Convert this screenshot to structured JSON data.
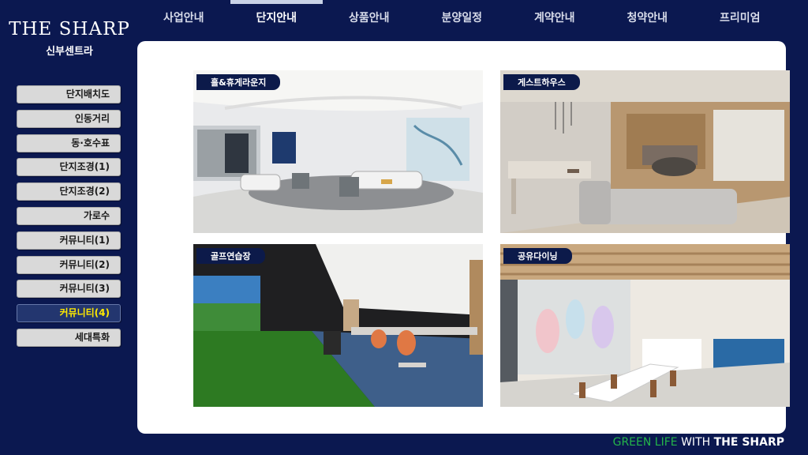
{
  "logo": {
    "main": "THE SHARP",
    "sub": "신부센트라"
  },
  "nav": {
    "tabs": [
      "사업안내",
      "단지안내",
      "상품안내",
      "분양일정",
      "계약안내",
      "청약안내",
      "프리미엄"
    ],
    "active": 1
  },
  "sidebar": {
    "items": [
      "단지배치도",
      "인동거리",
      "동·호수표",
      "단지조경(1)",
      "단지조경(2)",
      "가로수",
      "커뮤니티(1)",
      "커뮤니티(2)",
      "커뮤니티(3)",
      "커뮤니티(4)",
      "세대특화"
    ],
    "active": 9
  },
  "cards": [
    {
      "label": "홀&휴게라운지"
    },
    {
      "label": "게스트하우스"
    },
    {
      "label": "골프연습장"
    },
    {
      "label": "공유다이닝"
    }
  ],
  "footer": {
    "part1": "GREEN LIFE",
    "part2": "WITH",
    "part3": "THE SHARP"
  },
  "colors": {
    "background": "#0b1850",
    "active_sidebar": "#23366f",
    "active_text": "#ffea00",
    "label_bg": "#0c1a4a"
  }
}
